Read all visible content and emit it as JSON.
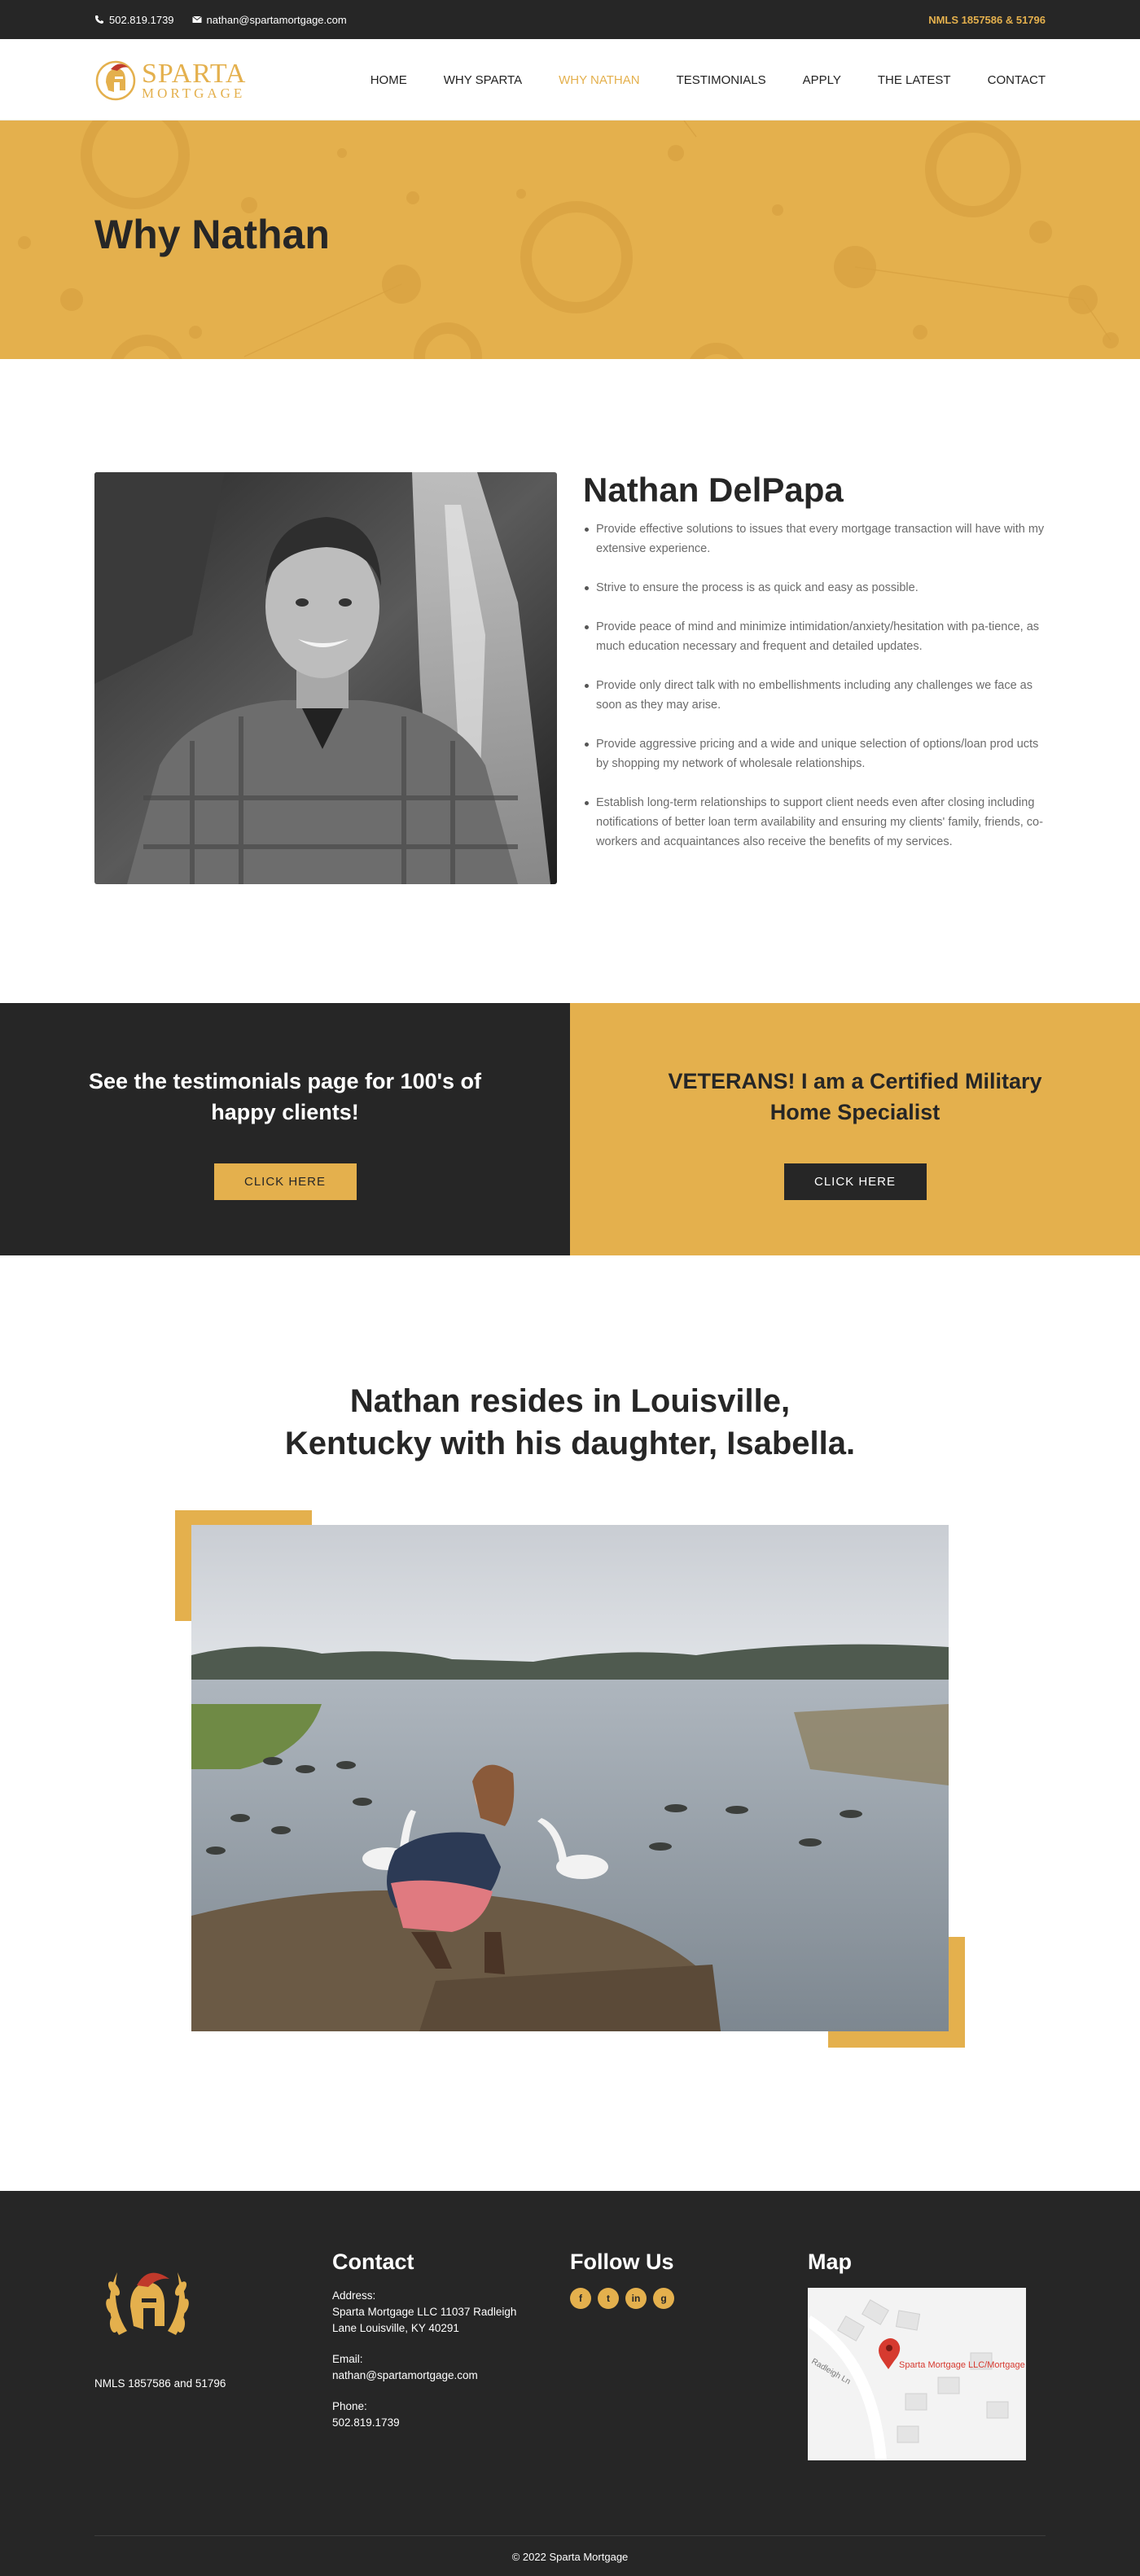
{
  "topbar": {
    "phone": "502.819.1739",
    "email": "nathan@spartamortgage.com",
    "nmls": "NMLS 1857586 & 51796"
  },
  "logo": {
    "line1": "SPARTA",
    "line2": "MORTGAGE"
  },
  "nav": [
    "HOME",
    "WHY SPARTA",
    "WHY NATHAN",
    "TESTIMONIALS",
    "APPLY",
    "THE LATEST",
    "CONTACT"
  ],
  "hero": {
    "title": "Why Nathan"
  },
  "bio": {
    "name": "Nathan DelPapa",
    "points": [
      "Provide effective solutions to issues that every mortgage transaction will have with my extensive experience.",
      "Strive to ensure the process is as quick and easy as possible.",
      "Provide peace of mind and minimize intimidation/anxiety/hesitation with pa-tience, as much education necessary and frequent and detailed updates.",
      "Provide only direct talk with no embellishments including any challenges we face as soon as they may arise.",
      "Provide aggressive pricing and a wide and unique selection of options/loan prod ucts by shopping my network of wholesale relationships.",
      "Establish long-term relationships to support client needs even after closing including notifications of better loan term availability and ensuring my clients' family, friends, co-workers and acquaintances also receive the benefits of my services."
    ]
  },
  "cta": {
    "left": {
      "heading": "See the testimonials page for 100's of happy clients!",
      "button": "CLICK HERE"
    },
    "right": {
      "heading": "VETERANS! I am a Certified Military Home Specialist",
      "button": "CLICK HERE"
    }
  },
  "family": {
    "heading": "Nathan resides in Louisville, Kentucky with his daughter, Isabella."
  },
  "footer": {
    "nmls": "NMLS 1857586 and 51796",
    "contact": {
      "title": "Contact",
      "address_label": "Address:",
      "address": "Sparta Mortgage LLC 11037 Radleigh Lane Louisville, KY 40291",
      "email_label": "Email:",
      "email": "nathan@spartamortgage.com",
      "phone_label": "Phone:",
      "phone": "502.819.1739"
    },
    "follow": {
      "title": "Follow Us",
      "icons": [
        "f",
        "t",
        "in",
        "g"
      ]
    },
    "map": {
      "title": "Map",
      "pin_label": "Sparta Mortgage LLC/Mortgage With...",
      "street": "Radleigh Ln"
    },
    "copyright": "© 2022 Sparta Mortgage"
  },
  "colors": {
    "gold": "#e4b04d",
    "dark": "#262626"
  }
}
